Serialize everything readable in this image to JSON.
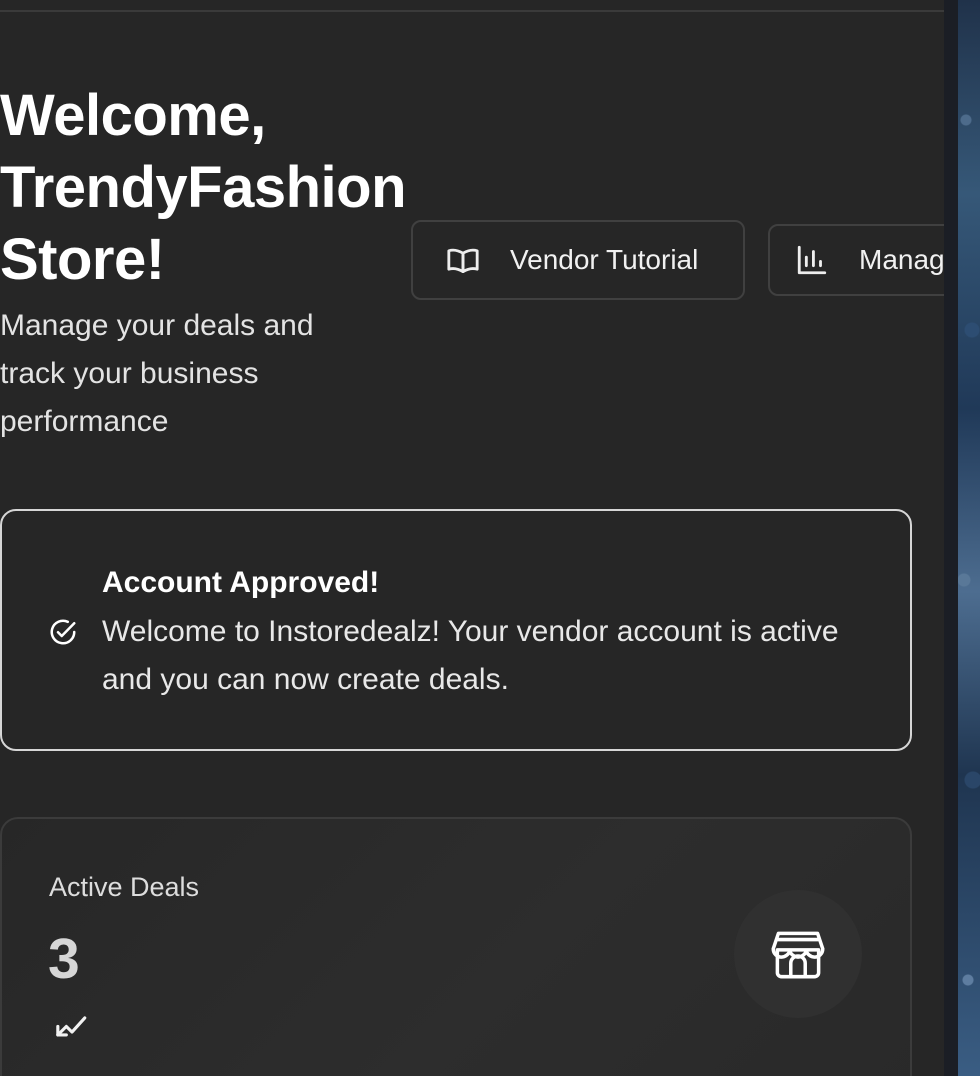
{
  "header": {
    "welcome": "Welcome, TrendyFashion Store!",
    "subtitle": "Manage your deals and track your business performance"
  },
  "actions": {
    "tutorial": {
      "label": "Vendor Tutorial",
      "icon": "book-open-icon"
    },
    "manage": {
      "label": "Manag",
      "icon": "bar-chart-icon"
    }
  },
  "approval": {
    "icon": "check-circle-icon",
    "title": "Account Approved!",
    "message": "Welcome to Instoredealz! Your vendor account is active and you can now create deals."
  },
  "stats": {
    "active_deals": {
      "label": "Active Deals",
      "value": "3",
      "trend_icon": "trending-up-icon",
      "badge_icon": "store-icon"
    }
  },
  "colors": {
    "background": "#262626",
    "text": "#ffffff",
    "muted_text": "#dddddd",
    "border": "#404040",
    "alert_border": "#d6d6d6",
    "icon_badge": "#303030"
  }
}
